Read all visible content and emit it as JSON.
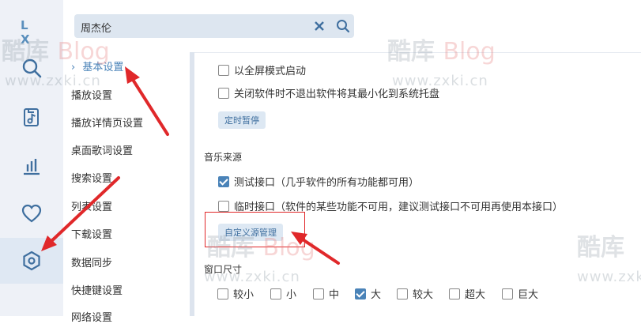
{
  "app": {
    "logo": "L X"
  },
  "search": {
    "value": "周杰伦"
  },
  "sidebar": {
    "icons": [
      "search-icon",
      "music-file-icon",
      "bar-chart-icon",
      "heart-icon",
      "settings-hexagon-icon"
    ],
    "active_icon": "settings-hexagon-icon"
  },
  "nav": {
    "items": [
      {
        "label": "基本设置",
        "active": true
      },
      {
        "label": "播放设置"
      },
      {
        "label": "播放详情页设置"
      },
      {
        "label": "桌面歌词设置"
      },
      {
        "label": "搜索设置"
      },
      {
        "label": "列表设置"
      },
      {
        "label": "下载设置"
      },
      {
        "label": "数据同步"
      },
      {
        "label": "快捷键设置"
      },
      {
        "label": "网络设置"
      }
    ],
    "active_marker": "›"
  },
  "basic": {
    "fullscreen_label": "以全屏模式启动",
    "minimize_tray_label": "关闭软件时不退出软件将其最小化到系统托盘",
    "timer_button": "定时暂停"
  },
  "music_source": {
    "title": "音乐来源",
    "options": [
      {
        "label": "测试接口（几乎软件的所有功能都可用）",
        "checked": true
      },
      {
        "label": "临时接口（软件的某些功能不可用，建议测试接口不可用再使用本接口）",
        "checked": false
      }
    ],
    "custom_button": "自定义源管理"
  },
  "window_size": {
    "title": "窗口尺寸",
    "options": [
      {
        "label": "较小",
        "checked": false
      },
      {
        "label": "小",
        "checked": false
      },
      {
        "label": "中",
        "checked": false
      },
      {
        "label": "大",
        "checked": true
      },
      {
        "label": "较大",
        "checked": false
      },
      {
        "label": "超大",
        "checked": false
      },
      {
        "label": "巨大",
        "checked": false
      }
    ]
  },
  "watermark": {
    "brand": "酷库",
    "blog": "Blog",
    "url": "www.zxki.cn"
  },
  "colors": {
    "accent": "#4a83b8",
    "annotation_red": "#e0282a",
    "rail_bg": "#eef1f7"
  }
}
